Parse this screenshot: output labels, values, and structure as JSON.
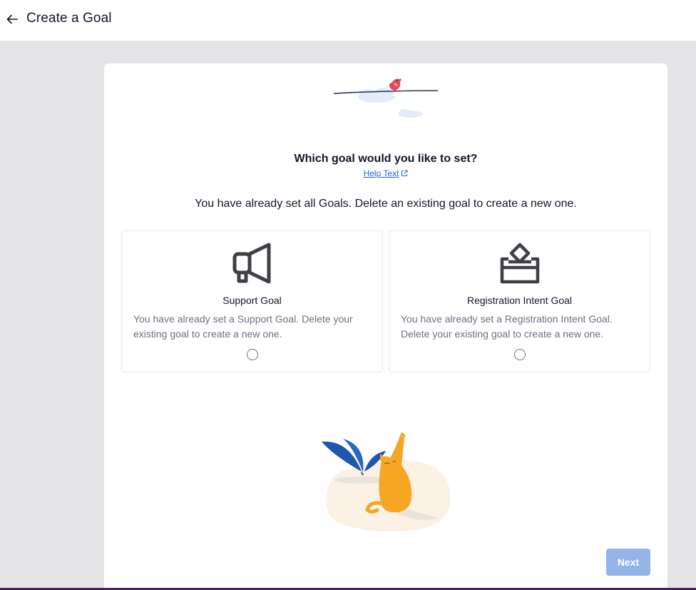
{
  "header": {
    "back_icon": "arrow-left-icon",
    "title": "Create a Goal"
  },
  "main": {
    "question": "Which goal would you like to set?",
    "help_link": {
      "label": "Help Text",
      "icon": "external-link-icon"
    },
    "notice": "You have already set all Goals. Delete an existing goal to create a new one.",
    "goals": [
      {
        "icon": "megaphone-icon",
        "title": "Support Goal",
        "description": "You have already set a Support Goal. Delete your existing goal to create a new one.",
        "selected": false
      },
      {
        "icon": "ballot-box-icon",
        "title": "Registration Intent Goal",
        "description": "You have already set a Registration Intent Goal. Delete your existing goal to create a new one.",
        "selected": false
      }
    ],
    "next_button": {
      "label": "Next",
      "disabled": true
    }
  },
  "colors": {
    "accent": "#2563eb",
    "button_disabled": "#93b4e6",
    "page_background": "#e4e4e7",
    "cat": "#f5a623",
    "plant": "#1e56b0",
    "bird": "#e8445a"
  }
}
